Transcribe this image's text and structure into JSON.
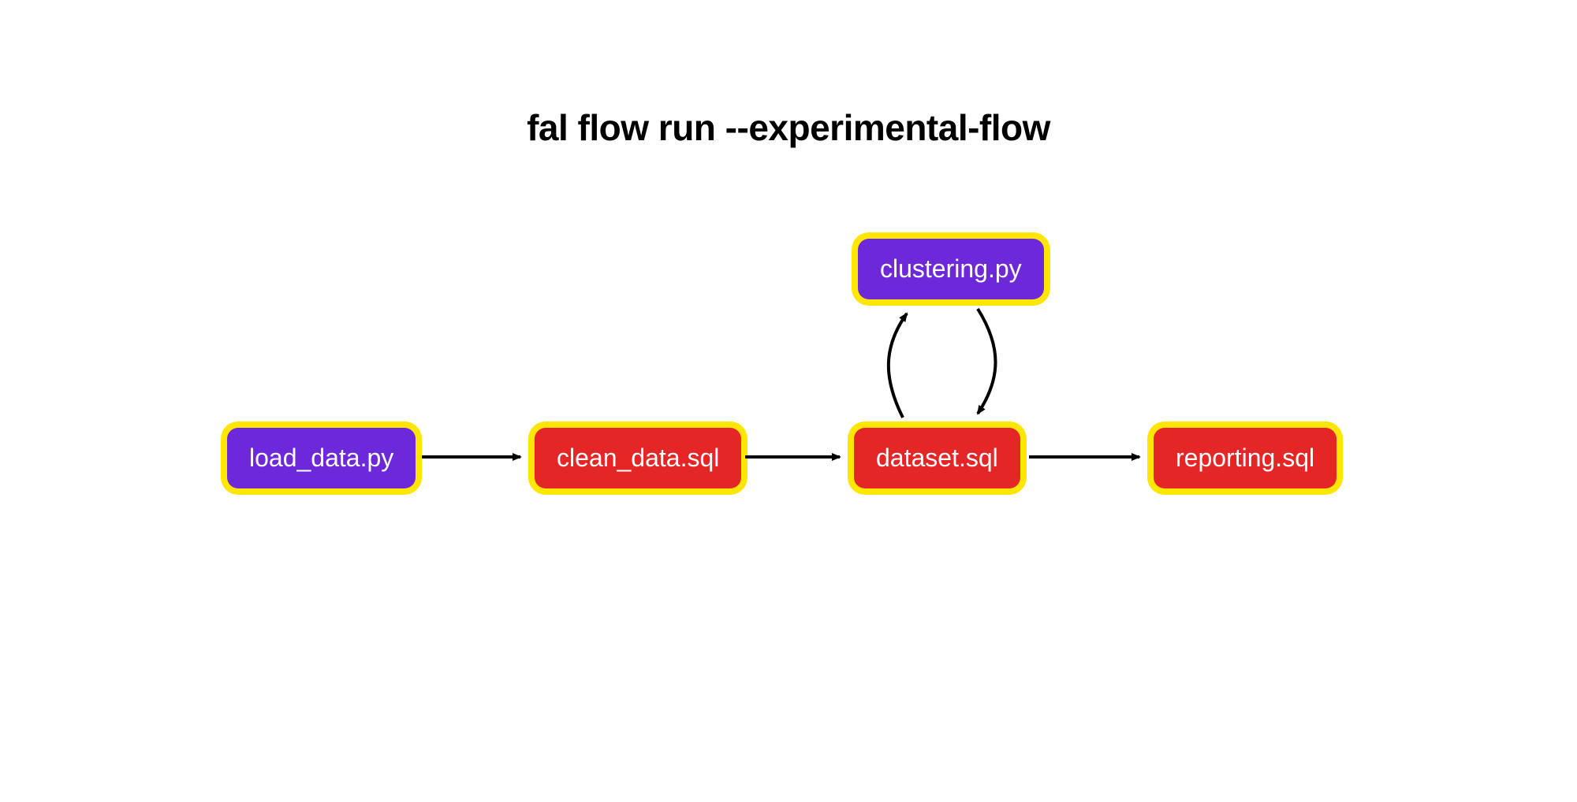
{
  "title": "fal flow run --experimental-flow",
  "nodes": {
    "load_data": {
      "label": "load_data.py",
      "kind": "python",
      "color": "purple"
    },
    "clean_data": {
      "label": "clean_data.sql",
      "kind": "sql",
      "color": "red"
    },
    "dataset": {
      "label": "dataset.sql",
      "kind": "sql",
      "color": "red"
    },
    "reporting": {
      "label": "reporting.sql",
      "kind": "sql",
      "color": "red"
    },
    "clustering": {
      "label": "clustering.py",
      "kind": "python",
      "color": "purple"
    }
  },
  "edges": [
    {
      "from": "load_data",
      "to": "clean_data",
      "style": "straight"
    },
    {
      "from": "clean_data",
      "to": "dataset",
      "style": "straight"
    },
    {
      "from": "dataset",
      "to": "reporting",
      "style": "straight"
    },
    {
      "from": "dataset",
      "to": "clustering",
      "style": "curve-up"
    },
    {
      "from": "clustering",
      "to": "dataset",
      "style": "curve-down"
    }
  ],
  "colors": {
    "purple": "#6d28d9",
    "red": "#e42626",
    "outline": "#ffe600",
    "arrow": "#000000"
  }
}
